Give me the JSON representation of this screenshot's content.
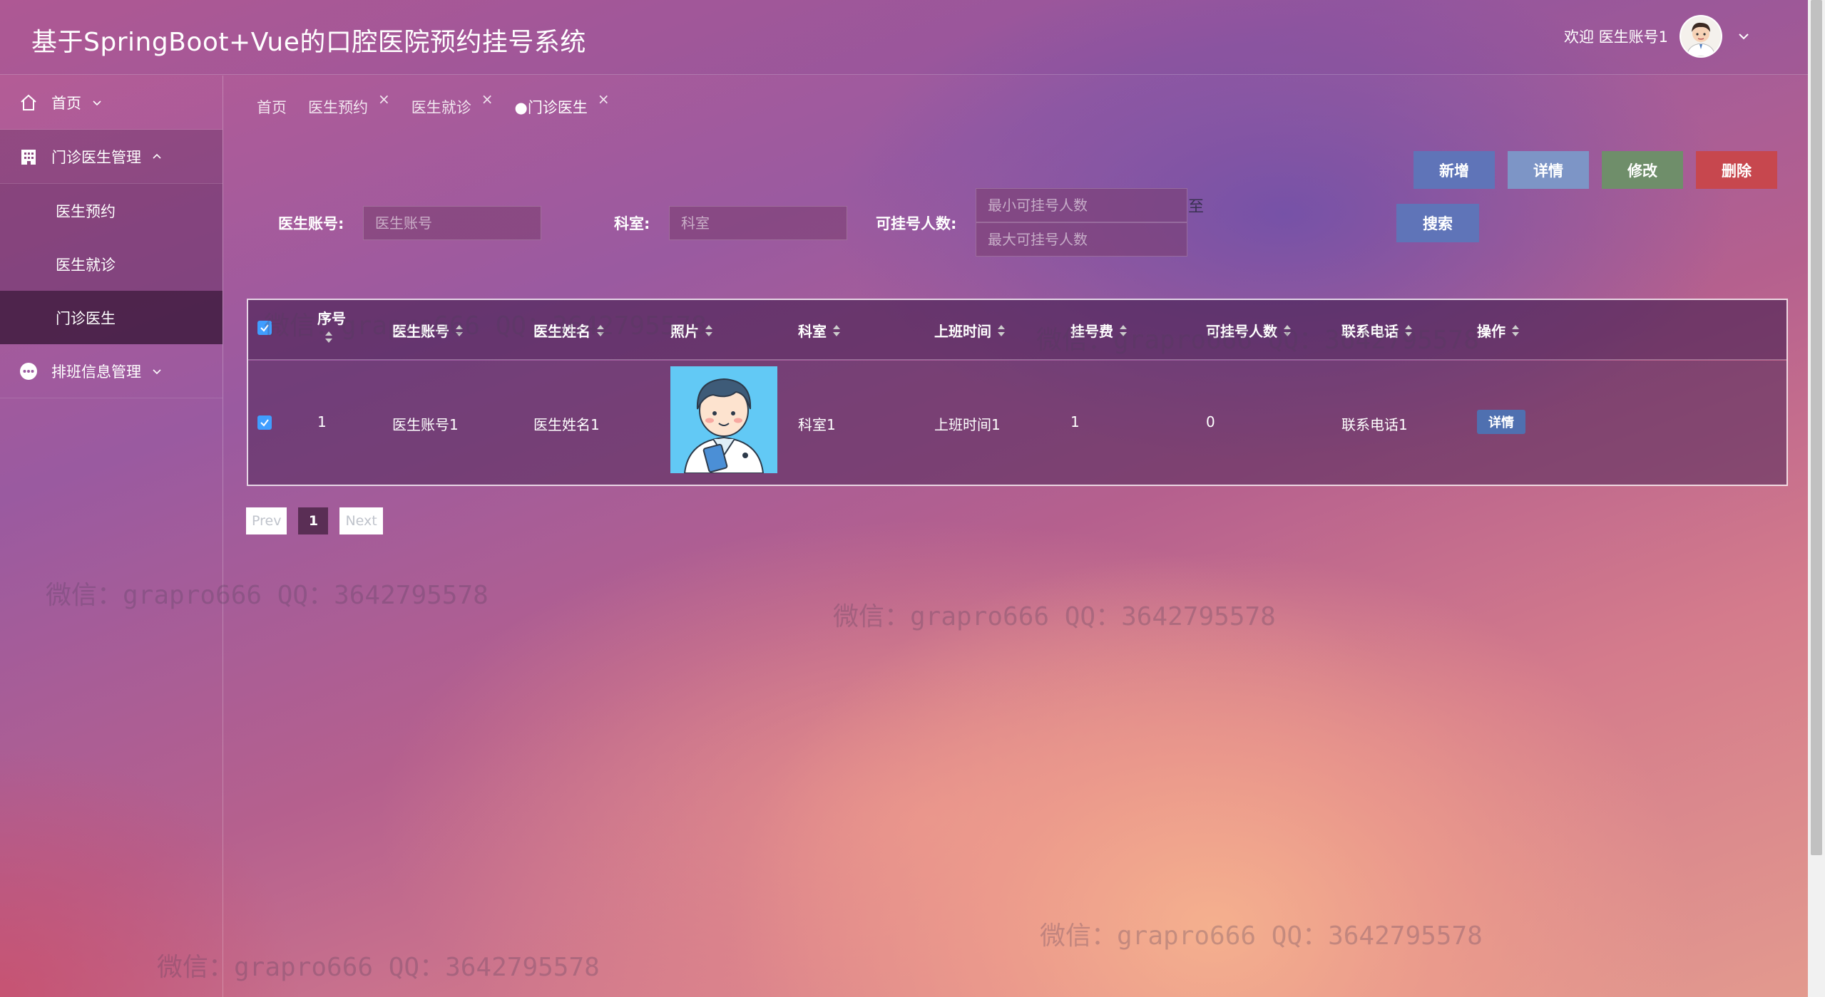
{
  "header": {
    "title": "基于SpringBoot+Vue的口腔医院预约挂号系统",
    "welcome": "欢迎 医生账号1"
  },
  "sidebar": {
    "items": [
      {
        "label": "首页",
        "icon": "home-icon"
      },
      {
        "label": "门诊医生管理",
        "icon": "building-icon"
      },
      {
        "label": "排班信息管理",
        "icon": "more-icon"
      }
    ],
    "submenu": [
      {
        "label": "医生预约"
      },
      {
        "label": "医生就诊"
      },
      {
        "label": "门诊医生"
      }
    ]
  },
  "tabs": [
    {
      "label": "首页"
    },
    {
      "label": "医生预约"
    },
    {
      "label": "医生就诊"
    },
    {
      "label": "●门诊医生"
    }
  ],
  "actions": {
    "add": "新增",
    "detail": "详情",
    "edit": "修改",
    "delete": "删除"
  },
  "search": {
    "account_label": "医生账号:",
    "account_placeholder": "医生账号",
    "dept_label": "科室:",
    "dept_placeholder": "科室",
    "count_label": "可挂号人数:",
    "min_placeholder": "最小可挂号人数",
    "max_placeholder": "最大可挂号人数",
    "range_sep": "至",
    "search_button": "搜索"
  },
  "table": {
    "columns": [
      "序号",
      "医生账号",
      "医生姓名",
      "照片",
      "科室",
      "上班时间",
      "挂号费",
      "可挂号人数",
      "联系电话",
      "操作"
    ],
    "rows": [
      {
        "index": "1",
        "account": "医生账号1",
        "name": "医生姓名1",
        "dept": "科室1",
        "work_time": "上班时间1",
        "fee": "1",
        "available": "0",
        "phone": "联系电话1",
        "action": "详情"
      }
    ]
  },
  "pagination": {
    "prev": "Prev",
    "current": "1",
    "next": "Next"
  },
  "watermark": "微信：grapro666 QQ：3642795578",
  "colors": {
    "primary_button": "#5f74b8",
    "edit_button": "#6f8e6a",
    "delete_button": "#c7474e",
    "checkbox": "#409eff"
  }
}
